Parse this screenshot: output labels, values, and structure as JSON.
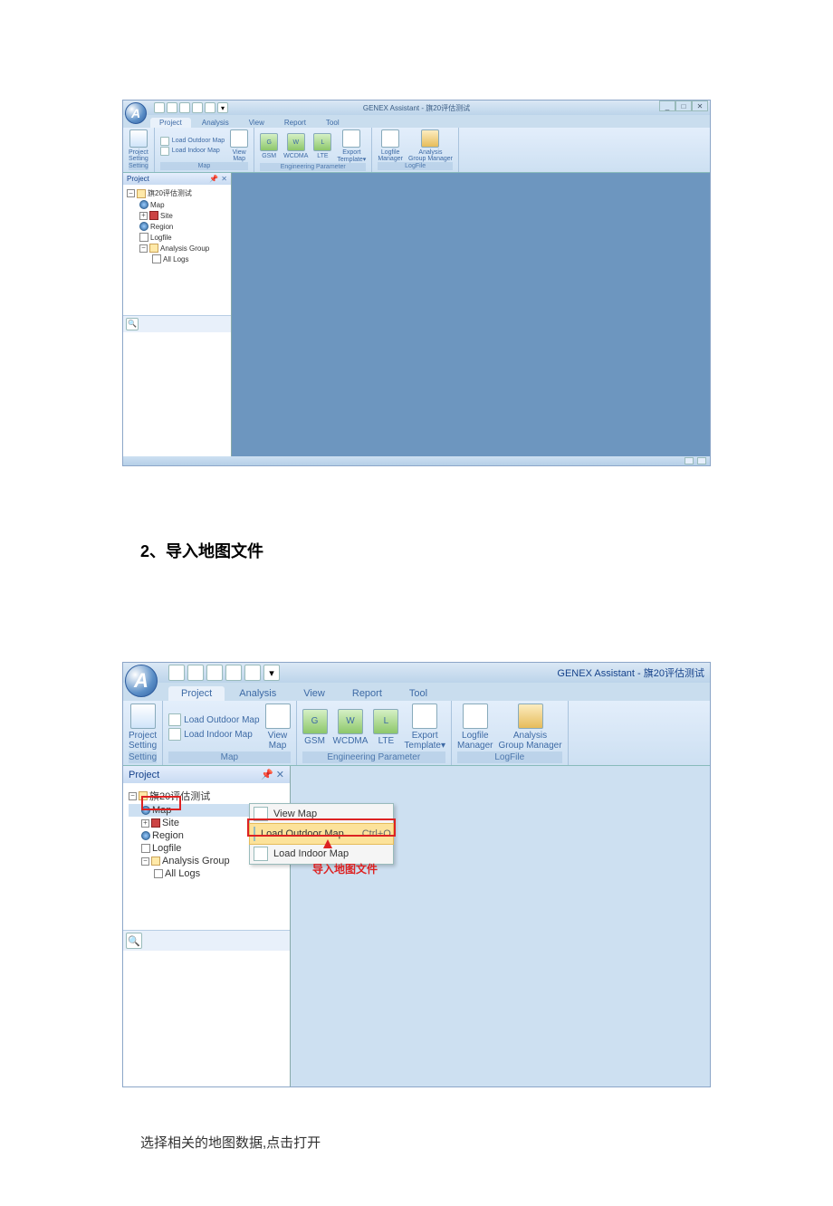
{
  "section_heading": "2、导入地图文件",
  "body_text": "选择相关的地图数据,点击打开",
  "app1": {
    "title": "GENEX Assistant - 旗20评估测试",
    "tabs": {
      "project": "Project",
      "analysis": "Analysis",
      "view": "View",
      "report": "Report",
      "tool": "Tool"
    },
    "ribbon": {
      "project_setting": "Project\nSetting",
      "load_outdoor": "Load Outdoor Map",
      "load_indoor": "Load Indoor Map",
      "view_map": "View\nMap",
      "gsm": "GSM",
      "wcdma": "WCDMA",
      "lte": "LTE",
      "export_template": "Export\nTemplate▾",
      "logfile_manager": "Logfile\nManager",
      "analysis_group_mgr": "Analysis\nGroup Manager",
      "grp_setting": "Setting",
      "grp_map": "Map",
      "grp_eng": "Engineering Parameter",
      "grp_logfile": "LogFile"
    },
    "sidebar": {
      "header": "Project",
      "root": "旗20评估测试",
      "map": "Map",
      "site": "Site",
      "region": "Region",
      "logfile": "Logfile",
      "analysis_group": "Analysis Group",
      "all_logs": "All Logs"
    }
  },
  "app2": {
    "title": "GENEX Assistant - 旗20评估测试",
    "tabs": {
      "project": "Project",
      "analysis": "Analysis",
      "view": "View",
      "report": "Report",
      "tool": "Tool"
    },
    "ribbon": {
      "project_setting": "Project\nSetting",
      "load_outdoor": "Load Outdoor Map",
      "load_indoor": "Load Indoor Map",
      "view_map": "View\nMap",
      "gsm": "GSM",
      "wcdma": "WCDMA",
      "lte": "LTE",
      "export_template": "Export\nTemplate▾",
      "logfile_manager": "Logfile\nManager",
      "analysis_group_mgr": "Analysis\nGroup Manager",
      "grp_setting": "Setting",
      "grp_map": "Map",
      "grp_eng": "Engineering Parameter",
      "grp_logfile": "LogFile"
    },
    "sidebar": {
      "header": "Project",
      "pin": "📌",
      "x": "✕",
      "root": "旗20评估测试",
      "map": "Map",
      "site": "Site",
      "region": "Region",
      "logfile": "Logfile",
      "analysis_group": "Analysis Group",
      "all_logs": "All Logs"
    },
    "context_menu": {
      "view_map": "View Map",
      "load_outdoor": "Load Outdoor Map",
      "load_outdoor_shortcut": "Ctrl+O",
      "load_indoor": "Load Indoor Map"
    },
    "callout": "导入地图文件"
  }
}
